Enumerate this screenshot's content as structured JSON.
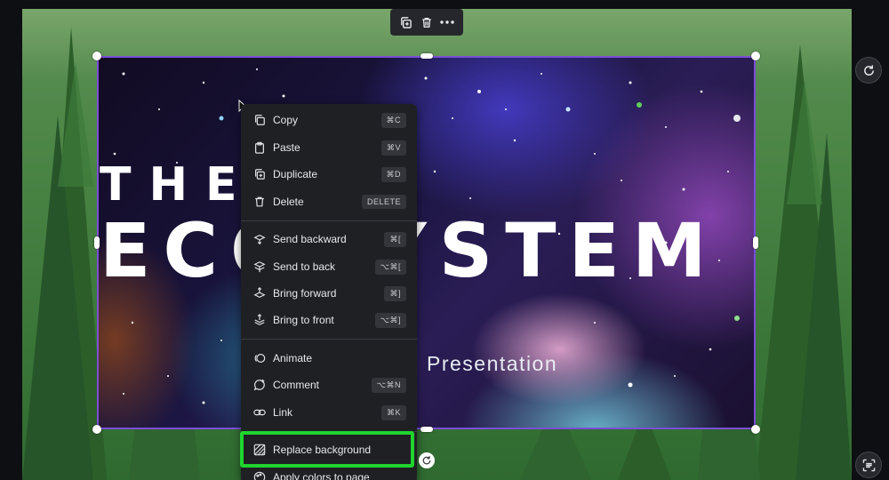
{
  "slide": {
    "title_line1": "THE",
    "title_line2": "ECOSYSTEM",
    "subtitle": "Presentation"
  },
  "toolbar": {
    "buttons": [
      "copy-duplicate-icon",
      "trash-icon",
      "more-icon"
    ]
  },
  "context_menu": {
    "items": [
      {
        "label": "Copy",
        "shortcut": "⌘C",
        "icon": "copy-icon"
      },
      {
        "label": "Paste",
        "shortcut": "⌘V",
        "icon": "clipboard-icon"
      },
      {
        "label": "Duplicate",
        "shortcut": "⌘D",
        "icon": "duplicate-icon"
      },
      {
        "label": "Delete",
        "shortcut": "DELETE",
        "icon": "trash-icon"
      },
      {
        "label": "Send backward",
        "shortcut": "⌘[",
        "icon": "send-backward-icon"
      },
      {
        "label": "Send to back",
        "shortcut": "⌥⌘[",
        "icon": "send-to-back-icon"
      },
      {
        "label": "Bring forward",
        "shortcut": "⌘]",
        "icon": "bring-forward-icon"
      },
      {
        "label": "Bring to front",
        "shortcut": "⌥⌘]",
        "icon": "bring-to-front-icon"
      },
      {
        "label": "Animate",
        "shortcut": "",
        "icon": "animate-icon"
      },
      {
        "label": "Comment",
        "shortcut": "⌥⌘N",
        "icon": "comment-icon"
      },
      {
        "label": "Link",
        "shortcut": "⌘K",
        "icon": "link-icon"
      },
      {
        "label": "Replace background",
        "shortcut": "",
        "icon": "replace-background-icon"
      },
      {
        "label": "Apply colors to page",
        "shortcut": "",
        "icon": "palette-icon"
      }
    ]
  },
  "colors": {
    "selection": "#7a4fd6",
    "highlight": "#1fd42e",
    "menu_bg": "#1f2024"
  }
}
